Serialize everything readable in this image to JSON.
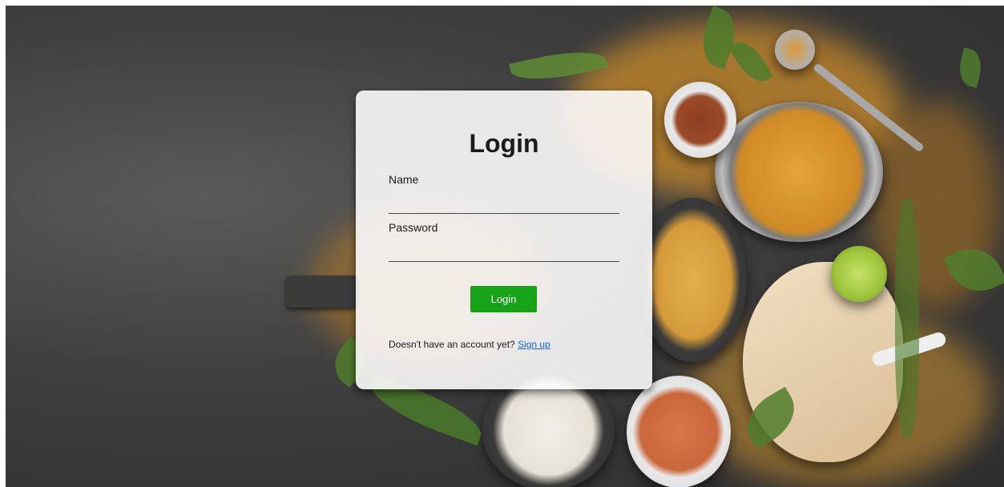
{
  "login": {
    "title": "Login",
    "name_label": "Name",
    "name_value": "",
    "password_label": "Password",
    "password_value": "",
    "submit_label": "Login",
    "signup_prompt": "Doesn't have an account yet?",
    "signup_link": "Sign up"
  },
  "colors": {
    "button": "#17a317",
    "link": "#1a62d9",
    "card": "#ffffff"
  }
}
